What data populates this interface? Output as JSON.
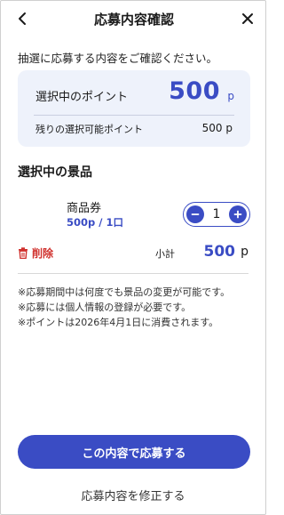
{
  "header": {
    "title": "応募内容確認"
  },
  "intro": "抽選に応募する内容をご確認ください。",
  "points": {
    "selected_label": "選択中のポイント",
    "selected_value": "500",
    "unit": "p",
    "remaining_label": "残りの選択可能ポイント",
    "remaining_value": "500 p"
  },
  "prizes": {
    "section_title": "選択中の景品",
    "item": {
      "name": "商品券",
      "price": "500p / 1口",
      "quantity": "1"
    },
    "delete_label": "削除",
    "subtotal_label": "小計",
    "subtotal_value": "500",
    "subtotal_unit": "p"
  },
  "notes": [
    "※応募期間中は何度でも景品の変更が可能です。",
    "※応募には個人情報の登録が必要です。",
    "※ポイントは2026年4月1日に消費されます。"
  ],
  "actions": {
    "submit_label": "この内容で応募する",
    "modify_label": "応募内容を修正する"
  },
  "colors": {
    "accent": "#3a4cc4",
    "danger": "#d0312d",
    "card_bg": "#eef2fb"
  }
}
